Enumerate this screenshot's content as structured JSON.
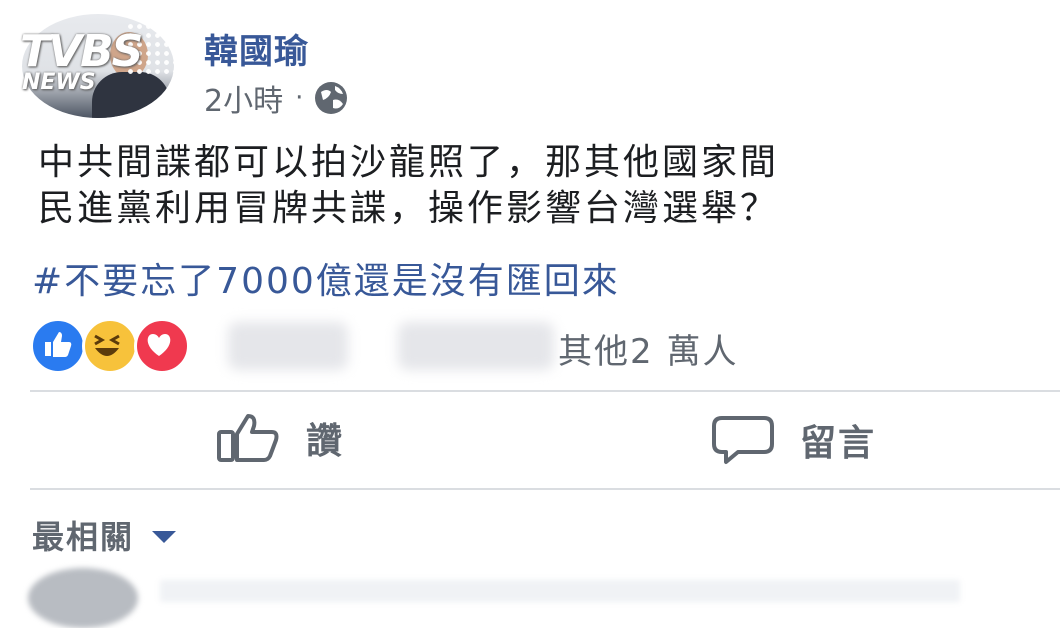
{
  "watermark": {
    "brand_top": "TVBS",
    "brand_bottom": "NEWS"
  },
  "post": {
    "author": "韓國瑜",
    "timestamp": "2小時",
    "separator": "·",
    "privacy_icon": "globe-icon",
    "text_line1": "中共間諜都可以拍沙龍照了，那其他國家間",
    "text_line2": "民進黨利用冒牌共諜，操作影響台灣選舉？",
    "hashtag": "#不要忘了7000億還是沒有匯回來",
    "reactions": {
      "icons": [
        "like-reaction-icon",
        "haha-reaction-icon",
        "love-reaction-icon"
      ],
      "summary": "其他2 萬人"
    },
    "actions": {
      "like_label": "讚",
      "comment_label": "留言"
    },
    "comments": {
      "sort_label": "最相關"
    }
  },
  "colors": {
    "link": "#385898",
    "secondary_text": "#606770",
    "like": "#2a7bf0",
    "haha": "#f7c23b",
    "love": "#f0394f"
  }
}
